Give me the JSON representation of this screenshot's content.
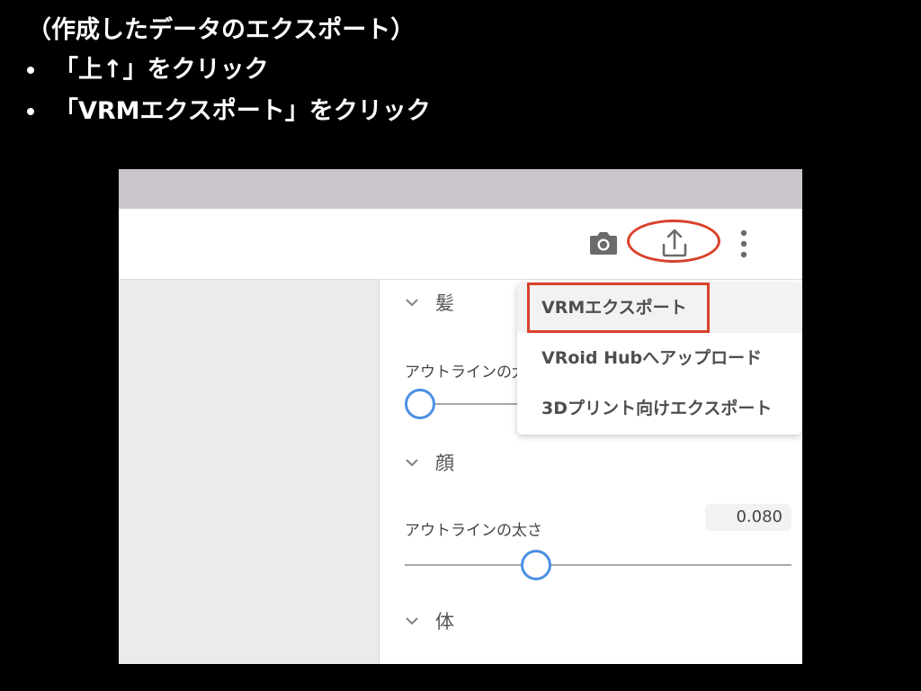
{
  "slide": {
    "title": "（作成したデータのエクスポート）",
    "bullets": [
      "「上↑」をクリック",
      "「VRMエクスポート」をクリック"
    ]
  },
  "app": {
    "toolbar": {
      "icons": [
        "camera-icon",
        "export-icon",
        "more-vert-icon"
      ]
    },
    "menu": {
      "items": [
        "VRMエクスポート",
        "VRoid Hubへアップロード",
        "3Dプリント向けエクスポート"
      ]
    },
    "sections": [
      {
        "label": "髪",
        "property": "アウトラインの太さ"
      },
      {
        "label": "顔",
        "property": "アウトラインの太さ",
        "value": "0.080",
        "slider_fraction": 0.34
      },
      {
        "label": "体"
      }
    ]
  },
  "colors": {
    "accent": "#4a90e2",
    "highlight": "#d9412a",
    "window_bar": "#cac5cc"
  }
}
